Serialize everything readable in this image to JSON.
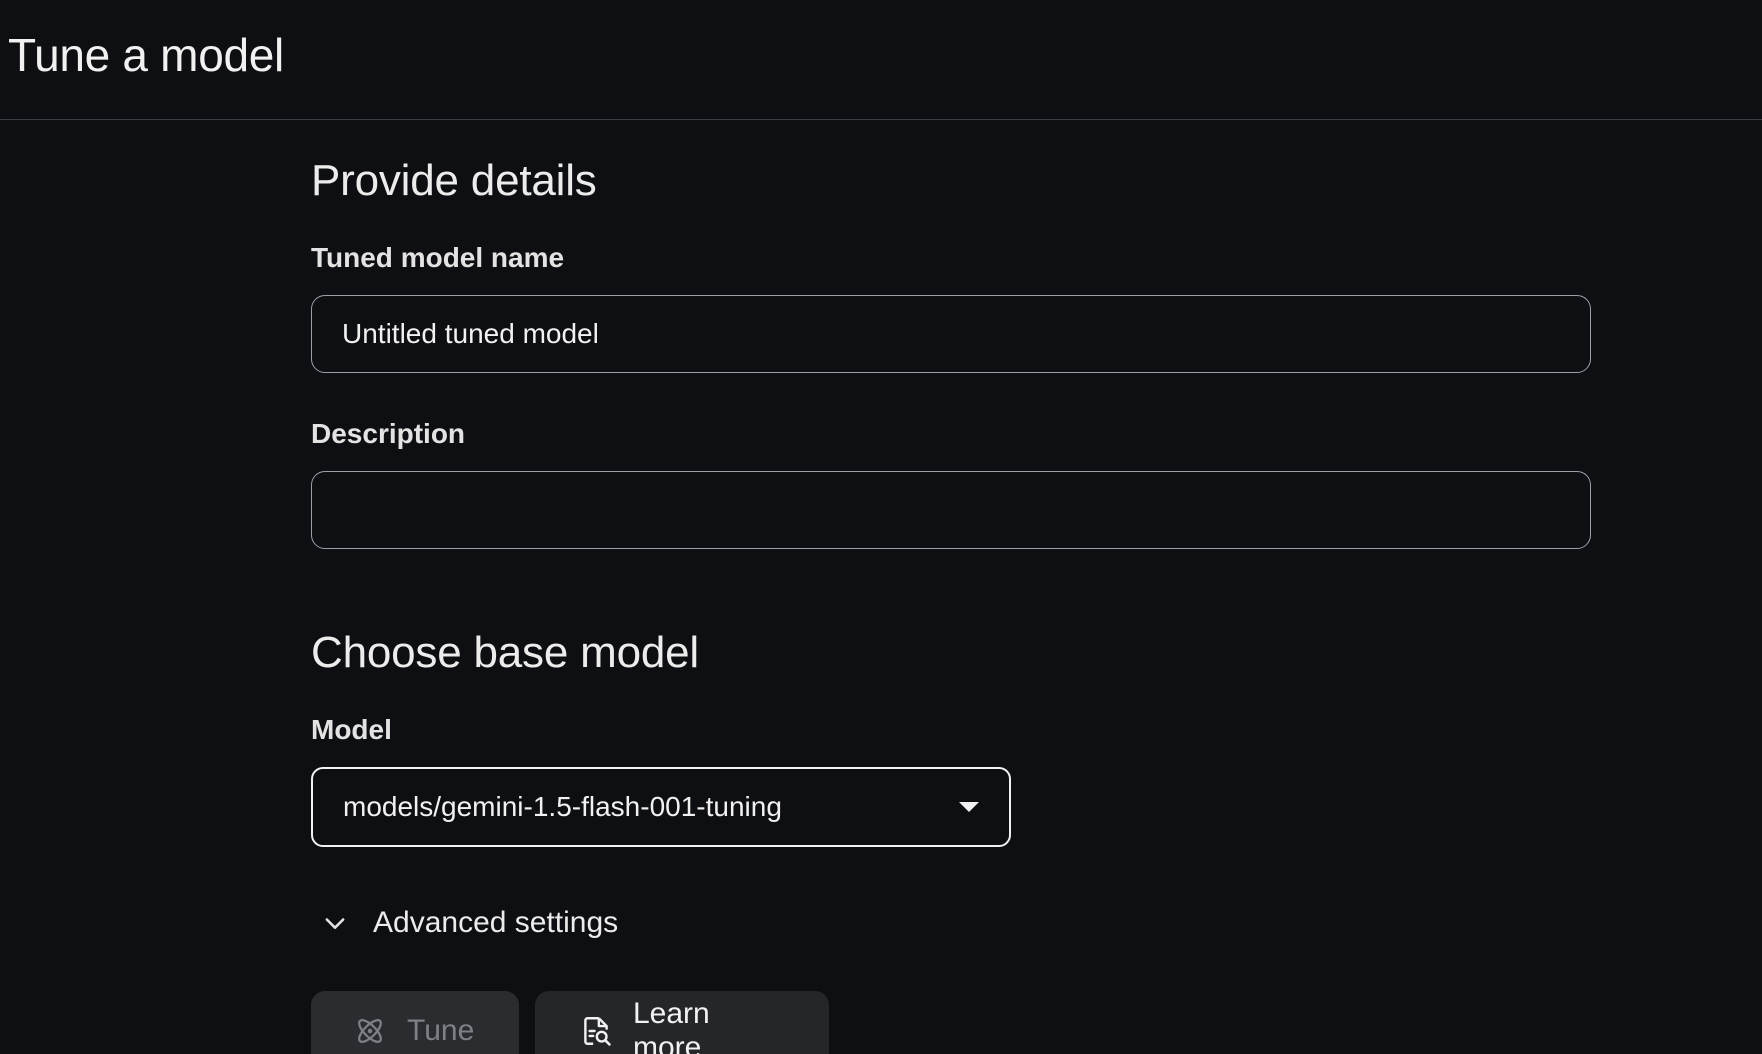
{
  "header": {
    "title": "Tune a model"
  },
  "details": {
    "section_title": "Provide details",
    "name_label": "Tuned model name",
    "name_value": "Untitled tuned model",
    "description_label": "Description",
    "description_value": ""
  },
  "base_model": {
    "section_title": "Choose base model",
    "model_label": "Model",
    "model_value": "models/gemini-1.5-flash-001-tuning",
    "advanced_label": "Advanced settings"
  },
  "actions": {
    "tune_label": "Tune",
    "learn_more_label": "Learn more"
  },
  "icons": {
    "tune": "atom-icon",
    "learn_more": "document-search-icon",
    "advanced": "chevron-down-icon",
    "select": "dropdown-caret-icon"
  }
}
